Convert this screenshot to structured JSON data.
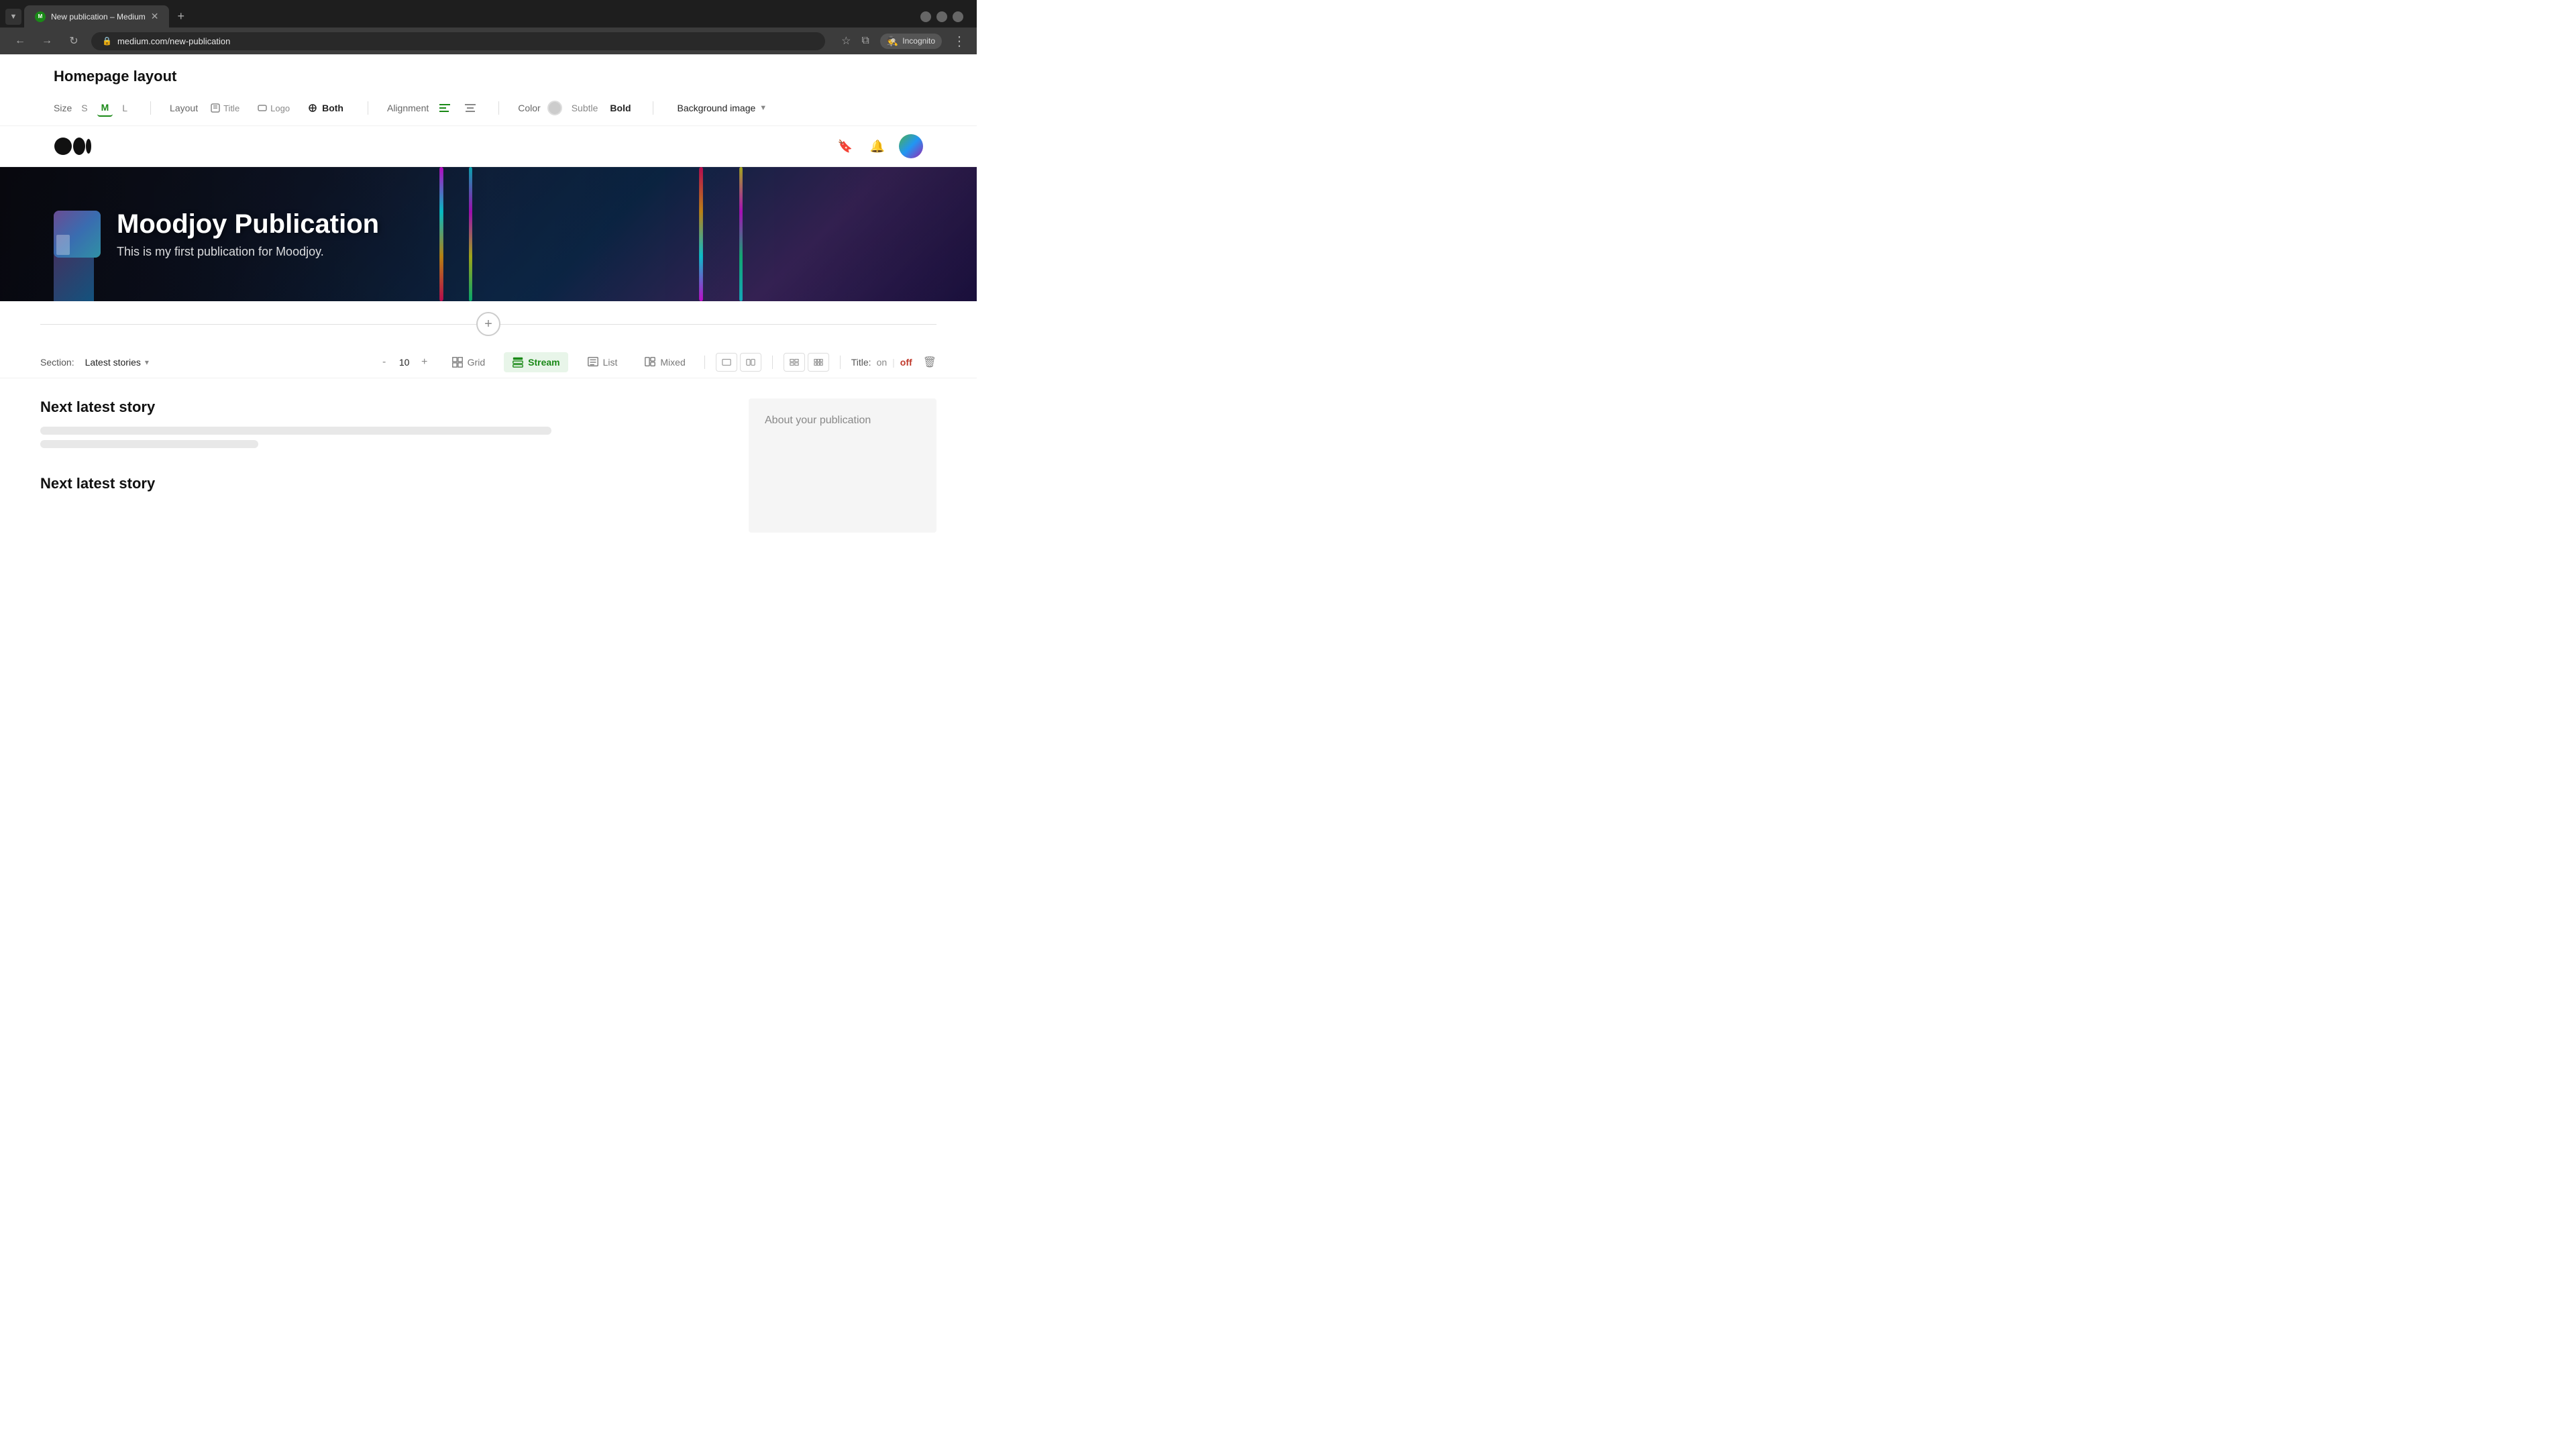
{
  "browser": {
    "tab_label": "New publication – Medium",
    "tab_favicon": "M",
    "address": "medium.com/new-publication",
    "close_symbol": "✕",
    "plus_symbol": "+",
    "back_symbol": "←",
    "forward_symbol": "→",
    "reload_symbol": "↻",
    "star_symbol": "☆",
    "split_symbol": "⧉",
    "incognito_label": "Incognito",
    "menu_symbol": "⋮",
    "minimize_symbol": "–",
    "maximize_symbol": "□",
    "window_close_symbol": "✕"
  },
  "toolbar": {
    "homepage_layout_heading": "Homepage layout",
    "size_label": "Size",
    "size_s": "S",
    "size_m": "M",
    "size_l": "L",
    "layout_label": "Layout",
    "layout_title": "Title",
    "layout_logo": "Logo",
    "layout_both": "Both",
    "alignment_label": "Alignment",
    "color_label": "Color",
    "subtle_label": "Subtle",
    "bold_label": "Bold",
    "bg_image_label": "Background image",
    "chevron": "▼"
  },
  "medium_header": {
    "logo_text": "●●|",
    "bookmark_symbol": "⬜",
    "bell_symbol": "🔔"
  },
  "publication": {
    "title": "Moodjoy Publication",
    "description": "This is my first publication for Moodjoy."
  },
  "section": {
    "label": "Section:",
    "name": "Latest stories",
    "chevron": "▾",
    "minus": "-",
    "count": "10",
    "plus": "+",
    "grid_label": "Grid",
    "stream_label": "Stream",
    "list_label": "List",
    "mixed_label": "Mixed",
    "title_label": "Title:",
    "on_label": "on",
    "separator": "|",
    "off_label": "off",
    "delete_symbol": "🗑"
  },
  "content": {
    "next_story_1": "Next latest story",
    "next_story_2": "Next latest story",
    "about_label": "About your publication",
    "add_symbol": "+"
  }
}
